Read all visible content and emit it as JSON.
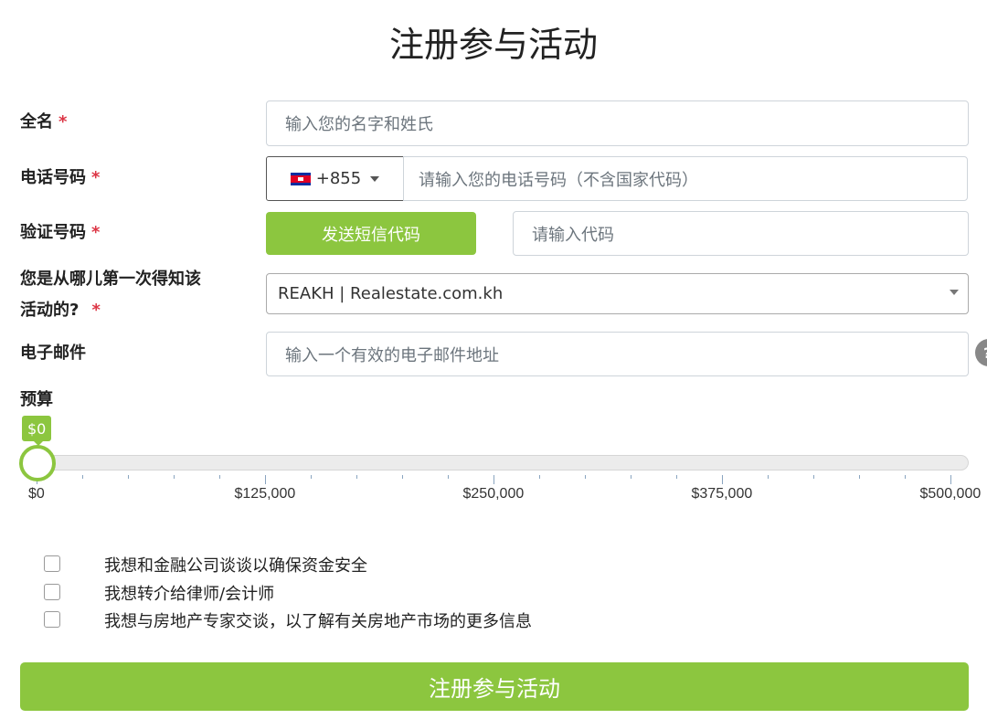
{
  "page": {
    "title": "注册参与活动"
  },
  "form": {
    "full_name": {
      "label": "全名",
      "required_mark": "*",
      "placeholder": "输入您的名字和姓氏"
    },
    "phone": {
      "label": "电话号码",
      "required_mark": "*",
      "country_code": "+855",
      "country_flag": "cambodia-flag-icon",
      "placeholder": "请输入您的电话号码（不含国家代码）"
    },
    "verification": {
      "label": "验证号码",
      "required_mark": "*",
      "send_button": "发送短信代码",
      "placeholder": "请输入代码"
    },
    "source": {
      "label_line1": "您是从哪儿第一次得知该",
      "label_line2": "活动的?",
      "required_mark": "*",
      "selected_value": "REAKH | Realestate.com.kh"
    },
    "email": {
      "label": "电子邮件",
      "placeholder": "输入一个有效的电子邮件地址"
    },
    "budget": {
      "label": "预算",
      "current_display": "$0",
      "value": 0,
      "min": 0,
      "max": 500000,
      "tick_labels": [
        "$0",
        "$125,000",
        "$250,000",
        "$375,000",
        "$500,000"
      ]
    },
    "checkboxes": [
      {
        "label": "我想和金融公司谈谈以确保资金安全",
        "checked": false
      },
      {
        "label": "我想转介给律师/会计师",
        "checked": false
      },
      {
        "label": "我想与房地产专家交谈，以了解有关房地产市场的更多信息",
        "checked": false
      }
    ],
    "submit_label": "注册参与活动"
  },
  "colors": {
    "accent": "#8cc63f",
    "required": "#dc3545"
  }
}
